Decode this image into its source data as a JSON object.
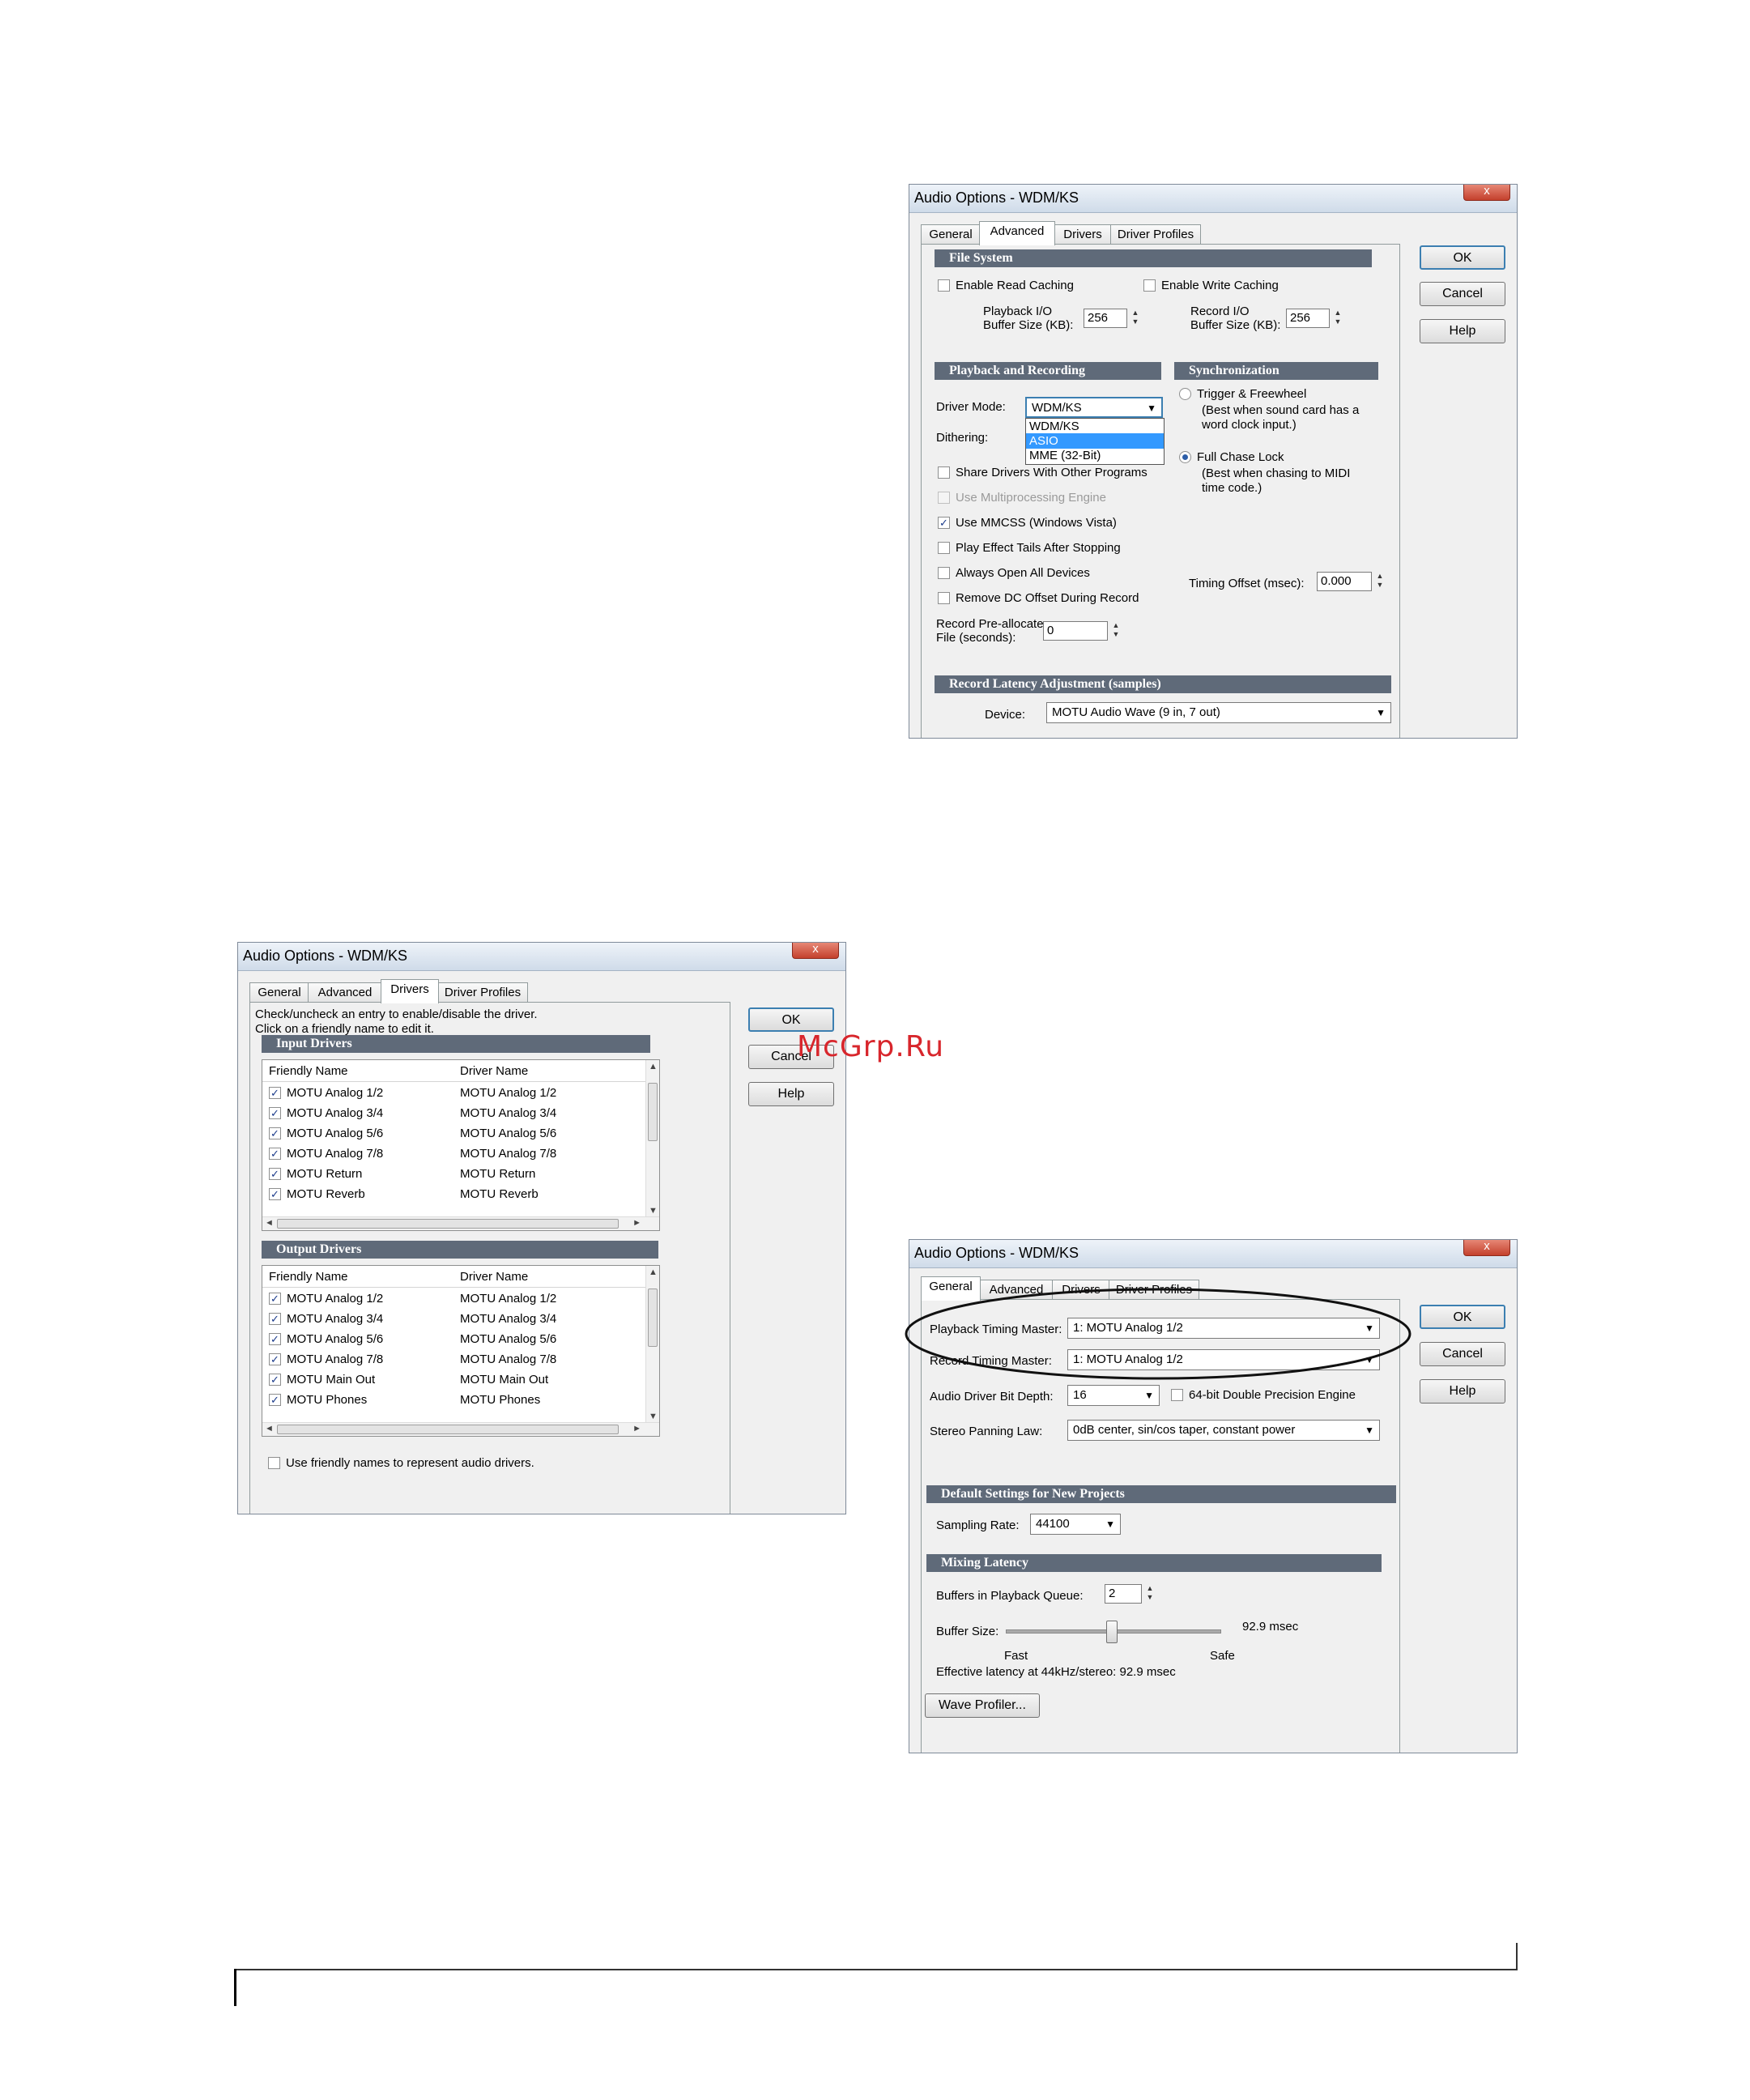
{
  "watermark": "McGrp.Ru",
  "win1": {
    "title": "Audio Options - WDM/KS",
    "close": "x",
    "tabs": [
      "General",
      "Advanced",
      "Drivers",
      "Driver Profiles"
    ],
    "buttons": {
      "ok": "OK",
      "cancel": "Cancel",
      "help": "Help"
    },
    "file_system": {
      "header": "File System",
      "read_caching": "Enable Read Caching",
      "write_caching": "Enable Write Caching",
      "playback_label_1": "Playback I/O",
      "playback_label_2": "Buffer Size (KB):",
      "playback_value": "256",
      "record_label_1": "Record I/O",
      "record_label_2": "Buffer Size (KB):",
      "record_value": "256"
    },
    "playback_recording": {
      "header": "Playback and Recording",
      "driver_mode_label": "Driver Mode:",
      "driver_mode_value": "WDM/KS",
      "driver_mode_options": [
        "WDM/KS",
        "ASIO",
        "MME (32-Bit)"
      ],
      "dithering_label": "Dithering:",
      "share_drivers": "Share Drivers With Other Programs",
      "multiprocessing": "Use Multiprocessing Engine",
      "mmcss": "Use MMCSS (Windows Vista)",
      "effect_tails": "Play Effect Tails After Stopping",
      "always_open": "Always Open All Devices",
      "remove_dc": "Remove DC Offset During Record",
      "preallocate_1": "Record Pre-allocate",
      "preallocate_2": "File (seconds):",
      "preallocate_value": "0"
    },
    "sync": {
      "header": "Synchronization",
      "trigger": "Trigger & Freewheel",
      "trigger_note_1": "(Best when sound card has a",
      "trigger_note_2": "word clock input.)",
      "full_chase": "Full Chase Lock",
      "chase_note_1": "(Best when chasing to MIDI",
      "chase_note_2": "time code.)",
      "timing_offset_label": "Timing Offset (msec):",
      "timing_offset_value": "0.000"
    },
    "latency": {
      "header": "Record Latency Adjustment (samples)",
      "device_label": "Device:",
      "device_value": "MOTU Audio Wave (9 in, 7 out)"
    }
  },
  "win2": {
    "title": "Audio Options - WDM/KS",
    "close": "x",
    "tabs": [
      "General",
      "Advanced",
      "Drivers",
      "Driver Profiles"
    ],
    "buttons": {
      "ok": "OK",
      "cancel": "Cancel",
      "help": "Help"
    },
    "instructions_1": "Check/uncheck an entry to enable/disable the driver.",
    "instructions_2": "Click on a friendly name to edit it.",
    "input_header": "Input Drivers",
    "output_header": "Output Drivers",
    "columns": [
      "Friendly Name",
      "Driver Name"
    ],
    "input_rows": [
      [
        "MOTU Analog 1/2",
        "MOTU Analog 1/2"
      ],
      [
        "MOTU Analog 3/4",
        "MOTU Analog 3/4"
      ],
      [
        "MOTU Analog 5/6",
        "MOTU Analog 5/6"
      ],
      [
        "MOTU Analog 7/8",
        "MOTU Analog 7/8"
      ],
      [
        "MOTU Return",
        "MOTU Return"
      ],
      [
        "MOTU Reverb",
        "MOTU Reverb"
      ]
    ],
    "output_rows": [
      [
        "MOTU Analog 1/2",
        "MOTU Analog 1/2"
      ],
      [
        "MOTU Analog 3/4",
        "MOTU Analog 3/4"
      ],
      [
        "MOTU Analog 5/6",
        "MOTU Analog 5/6"
      ],
      [
        "MOTU Analog 7/8",
        "MOTU Analog 7/8"
      ],
      [
        "MOTU Main Out",
        "MOTU Main Out"
      ],
      [
        "MOTU Phones",
        "MOTU Phones"
      ]
    ],
    "friendly_names": "Use friendly names to represent audio drivers."
  },
  "win3": {
    "title": "Audio Options - WDM/KS",
    "close": "x",
    "tabs": [
      "General",
      "Advanced",
      "Drivers",
      "Driver Profiles"
    ],
    "buttons": {
      "ok": "OK",
      "cancel": "Cancel",
      "help": "Help"
    },
    "playback_master_label": "Playback Timing Master:",
    "playback_master_value": "1: MOTU Analog 1/2",
    "record_master_label": "Record Timing Master:",
    "record_master_value": "1: MOTU Analog 1/2",
    "bit_depth_label": "Audio Driver Bit Depth:",
    "bit_depth_value": "16",
    "double_precision": "64-bit Double Precision Engine",
    "panning_label": "Stereo Panning Law:",
    "panning_value": "0dB center, sin/cos taper, constant power",
    "defaults_header": "Default Settings for New Projects",
    "sampling_label": "Sampling Rate:",
    "sampling_value": "44100",
    "mixing_header": "Mixing Latency",
    "buffers_label": "Buffers in Playback Queue:",
    "buffers_value": "2",
    "buffer_size_label": "Buffer Size:",
    "buffer_size_value": "92.9 msec",
    "slider_fast": "Fast",
    "slider_safe": "Safe",
    "buffer_slider_fraction": 0.49,
    "effective_latency": "Effective latency at 44kHz/stereo:  92.9 msec",
    "wave_profiler": "Wave Profiler..."
  }
}
